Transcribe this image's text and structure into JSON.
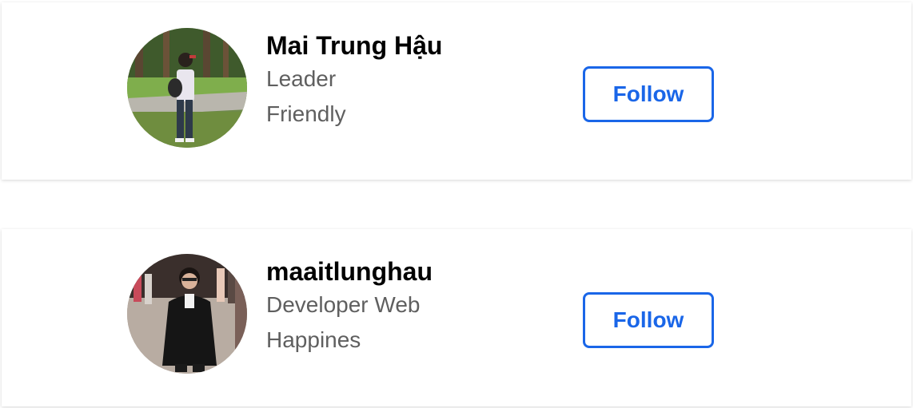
{
  "profiles": [
    {
      "name": "Mai Trung Hậu",
      "role": "Leader",
      "trait": "Friendly",
      "follow_label": "Follow"
    },
    {
      "name": "maaitlunghau",
      "role": "Developer Web",
      "trait": "Happines",
      "follow_label": "Follow"
    }
  ],
  "colors": {
    "accent": "#1a66e8",
    "name_text": "#000000",
    "secondary_text": "#5f5f5f"
  }
}
